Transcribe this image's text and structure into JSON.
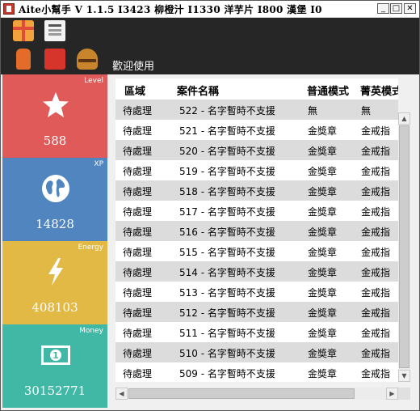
{
  "window": {
    "title": "Aite小幫手 V 1.1.5 I3423 柳橙汁 I1330 洋芋片 I800 漢堡 I0",
    "minimize": "_",
    "maximize": "□",
    "close": "✕"
  },
  "toolbar": {
    "welcome": "歡迎使用",
    "icons": [
      "gift-icon",
      "news-icon",
      "juice-icon",
      "chips-icon",
      "burger-icon"
    ]
  },
  "stats": [
    {
      "label": "Level",
      "value": "588",
      "color": "#e15a5a",
      "icon": "star-icon"
    },
    {
      "label": "XP",
      "value": "14828",
      "color": "#5085c0",
      "icon": "globe-icon"
    },
    {
      "label": "Energy",
      "value": "408103",
      "color": "#e3b945",
      "icon": "lightning-icon"
    },
    {
      "label": "Money",
      "value": "30152771",
      "color": "#41b8a5",
      "icon": "money-icon"
    }
  ],
  "table": {
    "headers": [
      "區域",
      "案件名稱",
      "普通模式",
      "菁英模式"
    ],
    "rows": [
      [
        "待處理",
        "522 - 名字暫時不支援",
        "無",
        "無"
      ],
      [
        "待處理",
        "521 - 名字暫時不支援",
        "金獎章",
        "金戒指"
      ],
      [
        "待處理",
        "520 - 名字暫時不支援",
        "金獎章",
        "金戒指"
      ],
      [
        "待處理",
        "519 - 名字暫時不支援",
        "金獎章",
        "金戒指"
      ],
      [
        "待處理",
        "518 - 名字暫時不支援",
        "金獎章",
        "金戒指"
      ],
      [
        "待處理",
        "517 - 名字暫時不支援",
        "金獎章",
        "金戒指"
      ],
      [
        "待處理",
        "516 - 名字暫時不支援",
        "金獎章",
        "金戒指"
      ],
      [
        "待處理",
        "515 - 名字暫時不支援",
        "金獎章",
        "金戒指"
      ],
      [
        "待處理",
        "514 - 名字暫時不支援",
        "金獎章",
        "金戒指"
      ],
      [
        "待處理",
        "513 - 名字暫時不支援",
        "金獎章",
        "金戒指"
      ],
      [
        "待處理",
        "512 - 名字暫時不支援",
        "金獎章",
        "金戒指"
      ],
      [
        "待處理",
        "511 - 名字暫時不支援",
        "金獎章",
        "金戒指"
      ],
      [
        "待處理",
        "510 - 名字暫時不支援",
        "金獎章",
        "金戒指"
      ],
      [
        "待處理",
        "509 - 名字暫時不支援",
        "金獎章",
        "金戒指"
      ]
    ]
  }
}
